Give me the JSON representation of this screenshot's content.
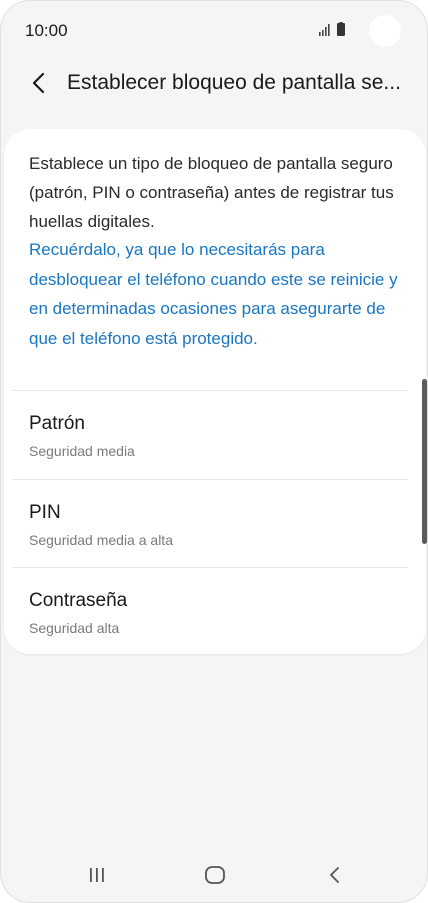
{
  "status_bar": {
    "time": "10:00"
  },
  "header": {
    "back_icon": "chevron-left-icon",
    "title": "Establecer bloqueo de pantalla se..."
  },
  "card": {
    "description": "Establece un tipo de bloqueo de pantalla seguro (patrón, PIN o contraseña) antes de registrar tus huellas digitales.",
    "note": "Recuérdalo, ya que lo necesitarás para desbloquear el teléfono cuando este se reinicie y en determinadas ocasiones para asegurarte de que el teléfono está protegido.",
    "options": [
      {
        "title": "Patrón",
        "subtitle": "Seguridad media"
      },
      {
        "title": "PIN",
        "subtitle": "Seguridad media a alta"
      },
      {
        "title": "Contraseña",
        "subtitle": "Seguridad alta"
      }
    ]
  },
  "nav_bar": {
    "recents_icon": "recents-icon",
    "home_icon": "home-icon",
    "back_icon": "back-icon"
  },
  "colors": {
    "background": "#f5f5f5",
    "card": "#ffffff",
    "accent_text": "#1976c2",
    "primary_text": "#1a1a1a",
    "secondary_text": "#7a7a7a"
  }
}
